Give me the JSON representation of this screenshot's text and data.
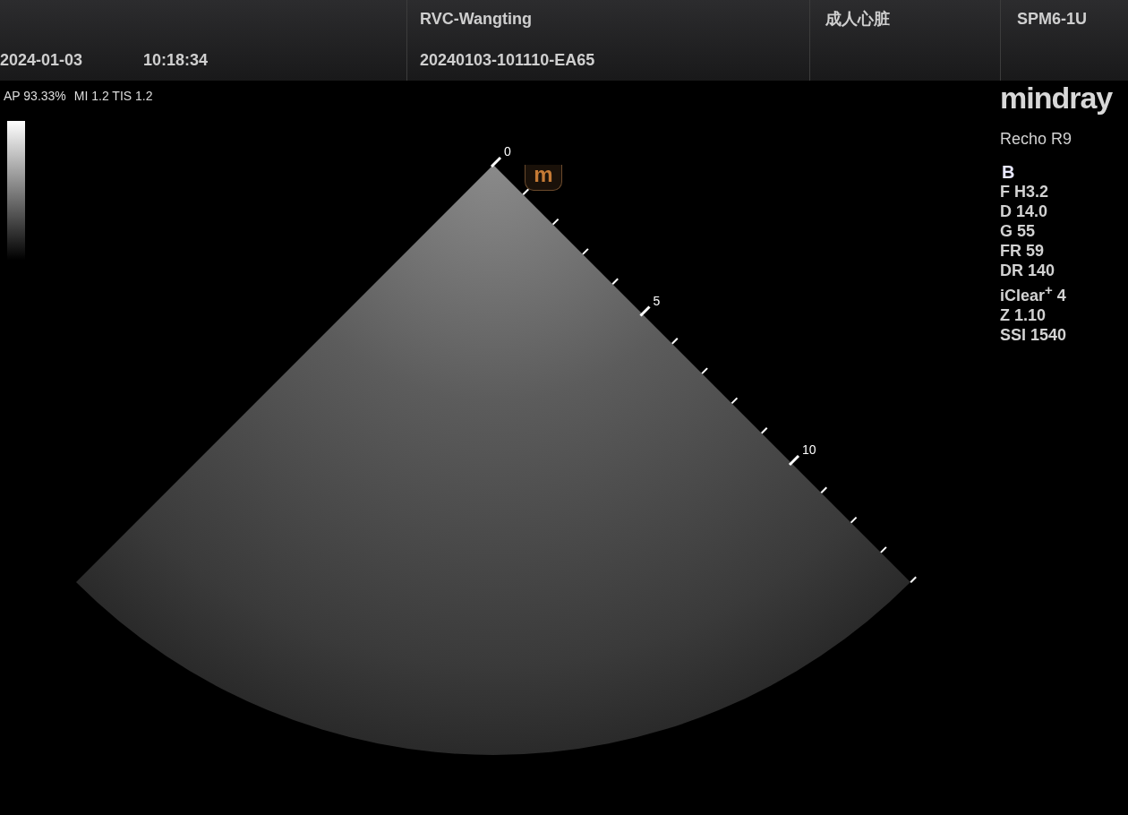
{
  "header": {
    "date": "2024-01-03",
    "time": "10:18:34",
    "patient_name": "RVC-Wangting",
    "exam_id": "20240103-101110-EA65",
    "exam_preset": "成人心脏",
    "probe": "SPM6-1U"
  },
  "acoustic_output": [
    "AP 93.33%",
    "MI 1.2 TIS 1.2"
  ],
  "brand": {
    "logo": "mindray",
    "model": "Recho R9"
  },
  "image_params": {
    "mode": "B",
    "params": [
      "F H3.2",
      "D 14.0",
      "G 55",
      "FR 59",
      "DR 140",
      "iClear$^{+}$ 4",
      "Z 1.10",
      "SSI 1540"
    ]
  },
  "orientation_marker": "m",
  "depth_labels": [
    "0",
    "5",
    "10"
  ]
}
